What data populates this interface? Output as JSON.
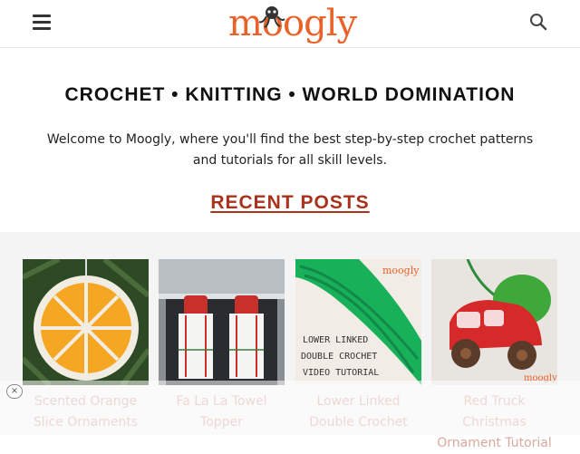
{
  "header": {
    "logo_text": "moogly",
    "menu_icon": "hamburger-menu-icon",
    "search_icon": "search-icon"
  },
  "tagline": "CROCHET • KNITTING • WORLD DOMINATION",
  "welcome_text": "Welcome to Moogly, where you'll find the best step-by-step crochet patterns and tutorials for all skill levels.",
  "recent_posts": {
    "heading": "RECENT POSTS",
    "items": [
      {
        "title": "Scented Orange Slice Ornaments",
        "image": "orange-slice-ornament-image"
      },
      {
        "title": "Fa La La Towel Topper",
        "image": "towel-topper-image"
      },
      {
        "title": "Lower Linked Double Crochet",
        "image": "linked-double-crochet-image",
        "image_text": [
          "LOWER LINKED",
          "DOUBLE CROCHET",
          "VIDEO TUTORIAL"
        ],
        "watermark": "moogly"
      },
      {
        "title": "Red Truck Christmas Ornament Tutorial",
        "image": "red-truck-ornament-image",
        "watermark": "moogly"
      }
    ]
  },
  "ad_close": "×",
  "colors": {
    "brand": "#e9622a",
    "heading_link": "#a8321c",
    "post_title": "#d9a89c"
  }
}
